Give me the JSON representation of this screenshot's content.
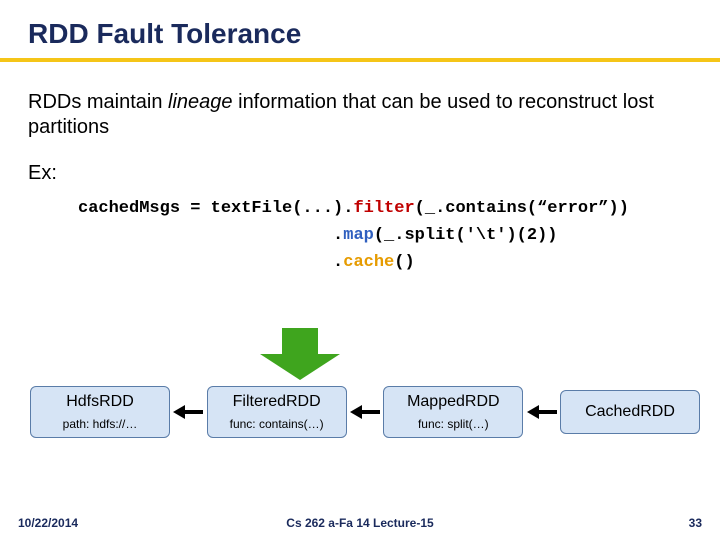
{
  "title": "RDD Fault Tolerance",
  "body": {
    "pre": "RDDs maintain ",
    "lineage": "lineage",
    "post": " information that can be used to reconstruct lost partitions"
  },
  "ex_label": "Ex:",
  "code": {
    "l1a": "cachedMsgs = textFile(...).",
    "l1b": "filter",
    "l1c": "(_.contains(“error”))",
    "l2a": "                         .",
    "l2b": "map",
    "l2c": "(_.split('\\t')(2))",
    "l3a": "                         .",
    "l3b": "cache",
    "l3c": "()"
  },
  "boxes": [
    {
      "name": "HdfsRDD",
      "sub": "path: hdfs://…"
    },
    {
      "name": "FilteredRDD",
      "sub": "func: contains(…)"
    },
    {
      "name": "MappedRDD",
      "sub": "func: split(…)"
    },
    {
      "name": "CachedRDD",
      "sub": ""
    }
  ],
  "footer": {
    "date": "10/22/2014",
    "center": "Cs 262 a-Fa 14 Lecture-15",
    "page": "33"
  }
}
